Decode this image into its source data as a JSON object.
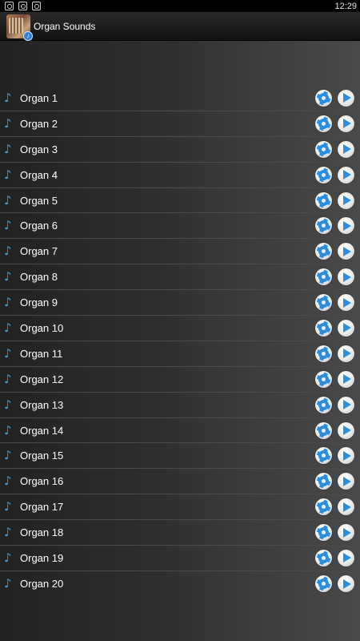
{
  "status_bar": {
    "time": "12:29",
    "icons": [
      "instagram-icon",
      "instagram-icon",
      "instagram-icon"
    ]
  },
  "app_bar": {
    "title": "Organ Sounds",
    "icon": "organ-app-icon"
  },
  "colors": {
    "accent": "#2a8fe0",
    "note": "#3aa0e8",
    "status_bar": "#000000",
    "row_divider": "#4b4b4b"
  },
  "sounds": [
    {
      "label": "Organ 1"
    },
    {
      "label": "Organ 2"
    },
    {
      "label": "Organ 3"
    },
    {
      "label": "Organ 4"
    },
    {
      "label": "Organ 5"
    },
    {
      "label": "Organ 6"
    },
    {
      "label": "Organ 7"
    },
    {
      "label": "Organ 8"
    },
    {
      "label": "Organ 9"
    },
    {
      "label": "Organ 10"
    },
    {
      "label": "Organ 11"
    },
    {
      "label": "Organ 12"
    },
    {
      "label": "Organ 13"
    },
    {
      "label": "Organ 14"
    },
    {
      "label": "Organ 15"
    },
    {
      "label": "Organ 16"
    },
    {
      "label": "Organ 17"
    },
    {
      "label": "Organ 18"
    },
    {
      "label": "Organ 19"
    },
    {
      "label": "Organ 20"
    }
  ]
}
